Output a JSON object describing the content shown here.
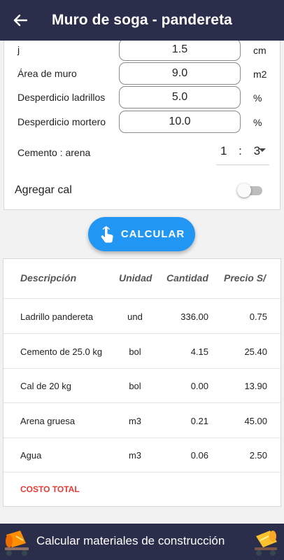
{
  "appbar": {
    "title": "Muro de soga - pandereta"
  },
  "form": {
    "rows": [
      {
        "label": "j",
        "value": "1.5",
        "unit": "cm"
      },
      {
        "label": "Área de muro",
        "value": "9.0",
        "unit": "m2"
      },
      {
        "label": "Desperdicio ladrillos",
        "value": "5.0",
        "unit": "%"
      },
      {
        "label": "Desperdicio mortero",
        "value": "10.0",
        "unit": "%"
      }
    ],
    "ratio_label": "Cemento : arena",
    "ratio_value": "1 : 3",
    "lime_label": "Agregar cal",
    "lime_enabled": false
  },
  "calc_button": {
    "label": "CALCULAR"
  },
  "table": {
    "headers": [
      "Descripción",
      "Unidad",
      "Cantidad",
      "Precio S/"
    ],
    "rows": [
      {
        "desc": "Ladrillo pandereta",
        "unit": "und",
        "qty": "336.00",
        "price": "0.75"
      },
      {
        "desc": "Cemento de 25.0 kg",
        "unit": "bol",
        "qty": "4.15",
        "price": "25.40"
      },
      {
        "desc": "Cal de 20 kg",
        "unit": "bol",
        "qty": "0.00",
        "price": "13.90"
      },
      {
        "desc": "Arena gruesa",
        "unit": "m3",
        "qty": "0.21",
        "price": "45.00"
      },
      {
        "desc": "Agua",
        "unit": "m3",
        "qty": "0.06",
        "price": "2.50"
      }
    ],
    "total_label": "COSTO TOTAL"
  },
  "banner": {
    "text": "Calcular materiales de construcción"
  },
  "colors": {
    "appbar": "#2b2e4a",
    "accent": "#2196f3",
    "total": "#e53935"
  }
}
